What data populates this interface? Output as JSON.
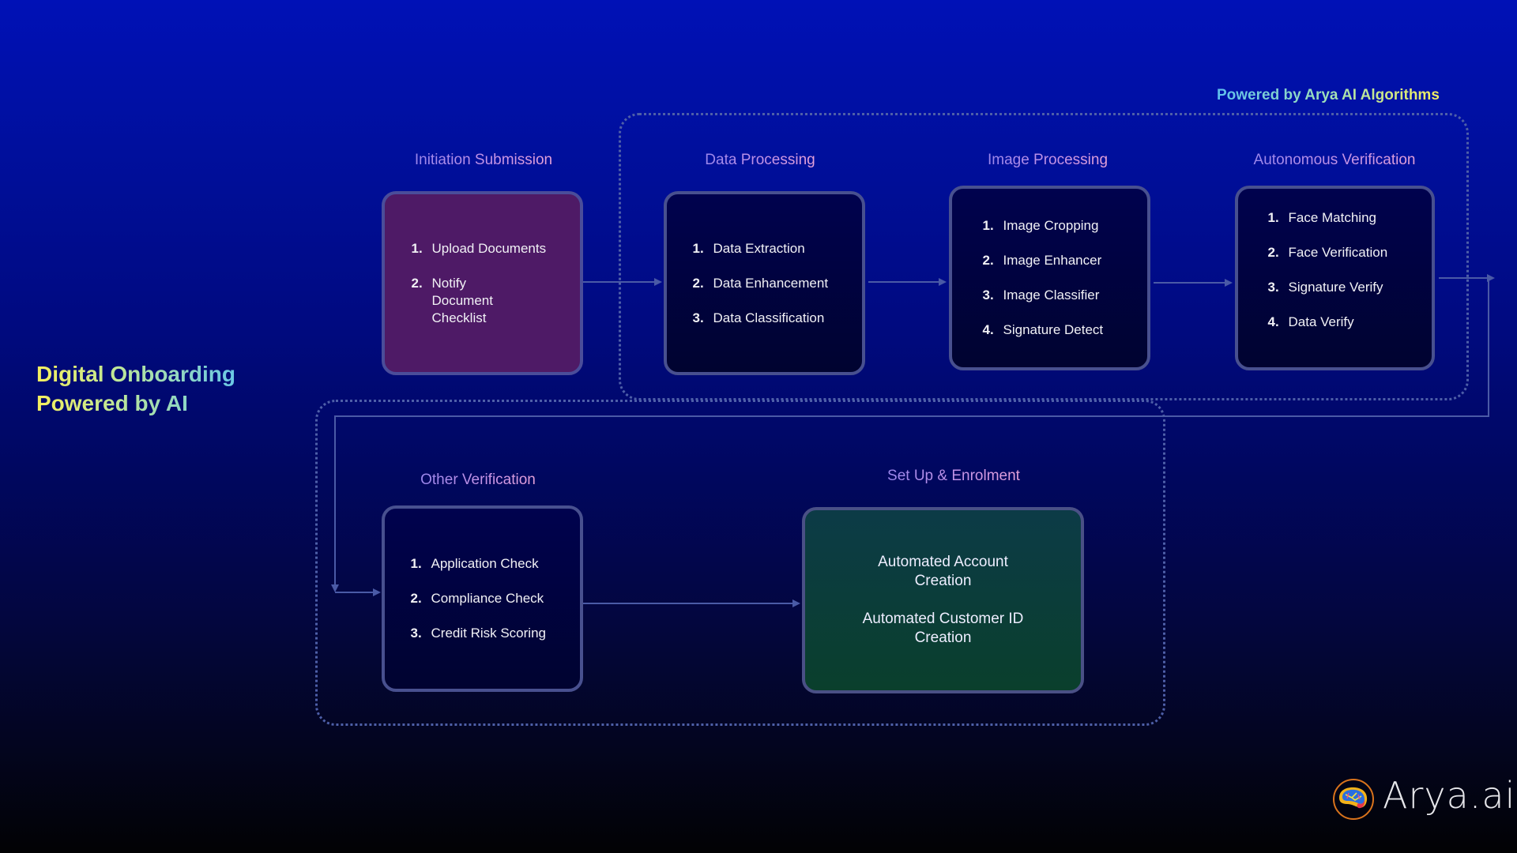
{
  "title": {
    "line1": "Digital Onboarding",
    "line2": "Powered by AI"
  },
  "ai_group_label": "Powered by Arya AI Algorithms",
  "stages": [
    {
      "label": "Initiation Submission",
      "items": [
        {
          "num": "1.",
          "text": "Upload Documents"
        },
        {
          "num": "2.",
          "text": "Notify Document Checklist"
        }
      ]
    },
    {
      "label": "Data Processing",
      "items": [
        {
          "num": "1.",
          "text": "Data Extraction"
        },
        {
          "num": "2.",
          "text": "Data Enhancement"
        },
        {
          "num": "3.",
          "text": "Data Classification"
        }
      ]
    },
    {
      "label": "Image Processing",
      "items": [
        {
          "num": "1.",
          "text": "Image Cropping"
        },
        {
          "num": "2.",
          "text": "Image Enhancer"
        },
        {
          "num": "3.",
          "text": "Image Classifier"
        },
        {
          "num": "4.",
          "text": "Signature Detect"
        }
      ]
    },
    {
      "label": "Autonomous Verification",
      "items": [
        {
          "num": "1.",
          "text": "Face Matching"
        },
        {
          "num": "2.",
          "text": "Face Verification"
        },
        {
          "num": "3.",
          "text": "Signature Verify"
        },
        {
          "num": "4.",
          "text": "Data Verify"
        }
      ]
    },
    {
      "label": "Other Verification",
      "items": [
        {
          "num": "1.",
          "text": "Application Check"
        },
        {
          "num": "2.",
          "text": "Compliance Check"
        },
        {
          "num": "3.",
          "text": "Credit Risk Scoring"
        }
      ]
    },
    {
      "label": "Set Up & Enrolment",
      "outputs": [
        "Automated Account Creation",
        "Automated Customer ID Creation"
      ]
    }
  ],
  "logo": {
    "text": "Arya.ai",
    "icon": "brain-logo-icon"
  },
  "colors": {
    "connector": "#4a5aa6",
    "dotted_border": "#4e5fa8",
    "initiation_card": "#4e1a66",
    "enrolment_card": "#0b3d3a"
  }
}
